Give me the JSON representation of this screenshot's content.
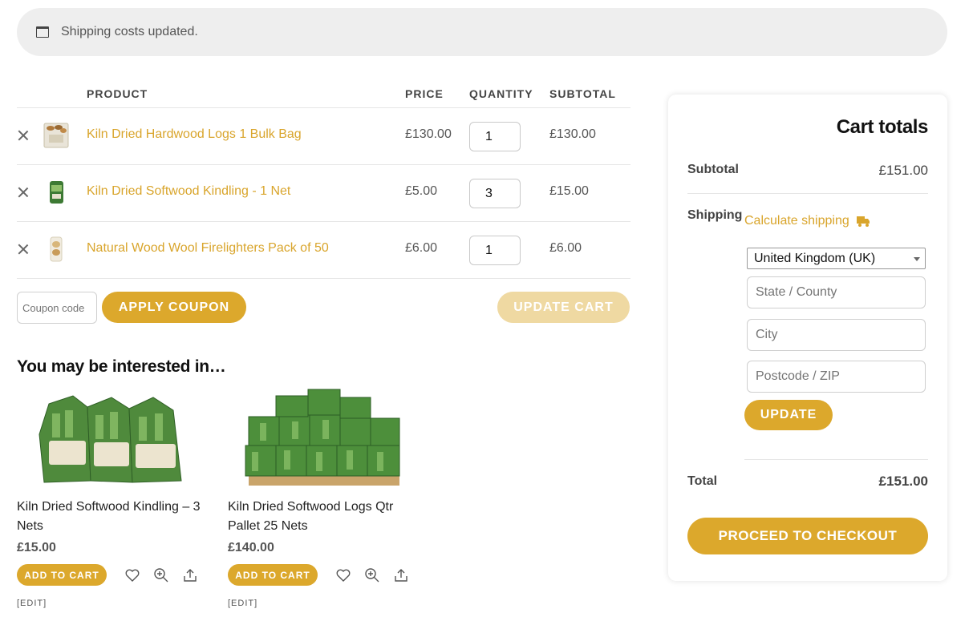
{
  "notice": {
    "text": "Shipping costs updated."
  },
  "cart": {
    "headers": {
      "product": "PRODUCT",
      "price": "PRICE",
      "quantity": "QUANTITY",
      "subtotal": "SUBTOTAL"
    },
    "items": [
      {
        "name": "Kiln Dried Hardwood Logs 1 Bulk Bag",
        "price": "£130.00",
        "qty": "1",
        "subtotal": "£130.00"
      },
      {
        "name": "Kiln Dried Softwood Kindling - 1 Net",
        "price": "£5.00",
        "qty": "3",
        "subtotal": "£15.00"
      },
      {
        "name": "Natural Wood Wool Firelighters Pack of 50",
        "price": "£6.00",
        "qty": "1",
        "subtotal": "£6.00"
      }
    ],
    "coupon_placeholder": "Coupon code",
    "apply_coupon_label": "APPLY COUPON",
    "update_cart_label": "UPDATE CART"
  },
  "crosssell": {
    "heading": "You may be interested in…",
    "products": [
      {
        "title": "Kiln Dried Softwood Kindling – 3 Nets",
        "price": "£15.00",
        "add_label": "ADD TO CART",
        "edit_label": "[EDIT]"
      },
      {
        "title": "Kiln Dried Softwood Logs Qtr Pallet 25 Nets",
        "price": "£140.00",
        "add_label": "ADD TO CART",
        "edit_label": "[EDIT]"
      }
    ]
  },
  "totals": {
    "title": "Cart totals",
    "subtotal_label": "Subtotal",
    "subtotal_value": "£151.00",
    "shipping_label": "Shipping",
    "calc_shipping_label": "Calculate shipping",
    "country_selected": "United Kingdom (UK)",
    "state_placeholder": "State / County",
    "city_placeholder": "City",
    "postcode_placeholder": "Postcode / ZIP",
    "update_label": "UPDATE",
    "total_label": "Total",
    "total_value": "£151.00",
    "checkout_label": "PROCEED TO CHECKOUT"
  },
  "colors": {
    "accent": "#dca82c",
    "link": "#d9a52c",
    "accent_disabled": "#efd9a2",
    "notice_bg": "#eeeeee"
  },
  "icons": [
    "window-icon",
    "remove-icon",
    "truck-icon",
    "heart-icon",
    "zoom-icon",
    "share-icon",
    "select-caret-icon"
  ]
}
